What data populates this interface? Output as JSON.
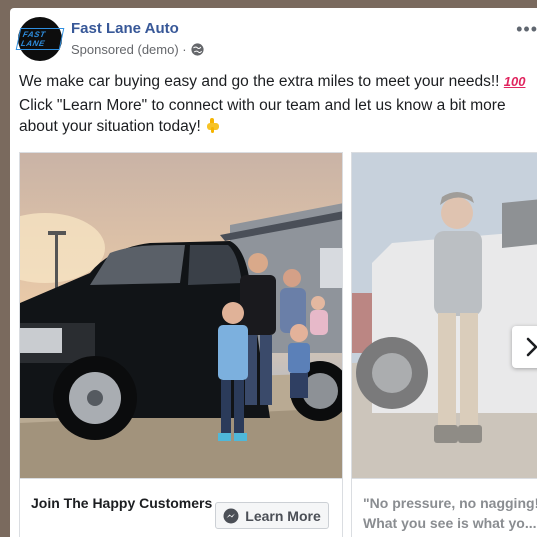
{
  "post": {
    "page_name": "Fast Lane Auto",
    "logo_text": "FAST LANE",
    "sponsored_label": "Sponsored (demo) ·",
    "more_label": "•••",
    "message_line1": "We make car buying easy and go the extra miles to meet your needs!!",
    "emoji_100": "100",
    "message_line2": "Click \"Learn More\" to connect with our team and let us know a bit more about your situation today!"
  },
  "carousel": {
    "cards": [
      {
        "title": "Join The Happy Customers",
        "cta_label": "Learn More"
      },
      {
        "title": "\"No pressure, no nagging!",
        "subtitle": "What you see is what yo..."
      }
    ]
  },
  "colors": {
    "brand_blue": "#385898",
    "logo_blue": "#2f8fe0",
    "truck": "#111417",
    "background": "#7a6a5e"
  },
  "icons": {
    "globe": "globe-icon",
    "messenger": "messenger-icon",
    "next": "chevron-right-icon",
    "pointing": "pointing-down-emoji-icon"
  }
}
